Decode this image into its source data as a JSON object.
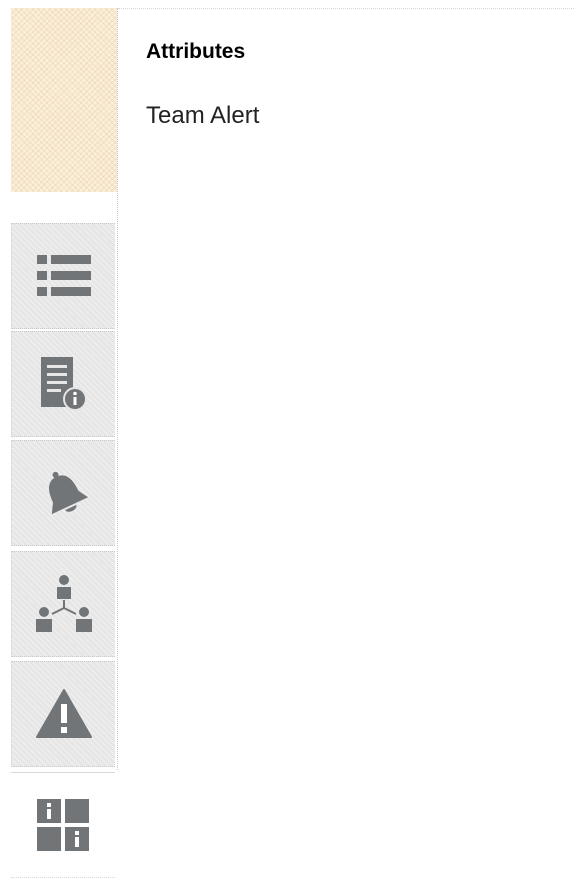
{
  "panel": {
    "title": "Attributes",
    "value": "Team Alert"
  },
  "tabs": [
    {
      "icon": "list-icon",
      "active": false
    },
    {
      "icon": "document-info-icon",
      "active": false
    },
    {
      "icon": "bell-icon",
      "active": false
    },
    {
      "icon": "team-hierarchy-icon",
      "active": false
    },
    {
      "icon": "warning-icon",
      "active": false
    },
    {
      "icon": "attributes-grid-icon",
      "active": true
    }
  ],
  "colors": {
    "icon": "#717578",
    "tab_background": "#e6e6e6",
    "header_swatch": "#fbefdc"
  }
}
